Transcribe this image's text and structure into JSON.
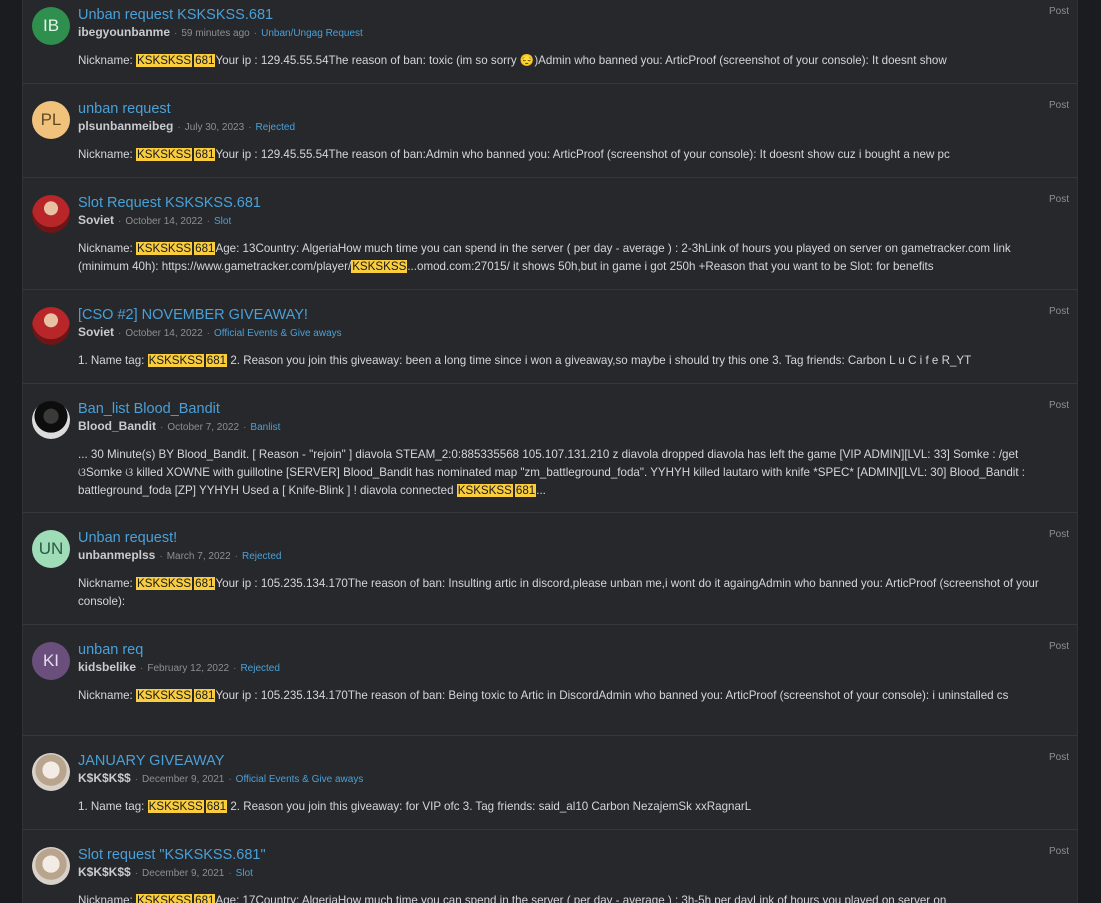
{
  "results": [
    {
      "title": "Unban request KSKSKSS.681",
      "avatar_initials": "IB",
      "avatar_color": "#2f8f4e",
      "author": "ibegyounbanme",
      "date": "59 minutes ago",
      "forum": "Unban/Ungag Request",
      "type": "Post",
      "snippet_pre": "Nickname: ",
      "hl1": "KSKSKSS",
      "hl2": "681",
      "snippet_post": "Your ip : 129.45.55.54The reason of ban: toxic (im so sorry 😔)Admin who banned you: ArticProof (screenshot of your console): It doesnt show"
    },
    {
      "title": "unban request",
      "avatar_initials": "PL",
      "avatar_color": "#f0c27b",
      "author": "plsunbanmeibeg",
      "date": "July 30, 2023",
      "forum": "Rejected",
      "type": "Post",
      "snippet_pre": "Nickname: ",
      "hl1": "KSKSKSS",
      "hl2": "681",
      "snippet_post": "Your ip : 129.45.55.54The reason of ban:Admin who banned you: ArticProof (screenshot of your console): It doesnt show cuz i bought a new pc"
    },
    {
      "title": "Slot Request KSKSKSS.681",
      "avatar_initials": "",
      "avatar_color": "#8b1a1a",
      "author": "Soviet",
      "date": "October 14, 2022",
      "forum": "Slot",
      "type": "Post",
      "snippet_pre": "Nickname: ",
      "hl1": "KSKSKSS",
      "hl2": "681",
      "snippet_mid": "Age: 13Country: AlgeriaHow much time you can spend in the server ( per day - average ) : 2-3hLink of hours you played on server on gametracker.com link (minimum 40h): https://www.gametracker.com/player/",
      "hl3": "KSKSKSS",
      "snippet_post": "...omod.com:27015/ it shows 50h,but in game i got 250h +Reason that you want to be Slot: for benefits"
    },
    {
      "title": "[CSO #2] NOVEMBER GIVEAWAY!",
      "avatar_initials": "",
      "avatar_color": "#8b1a1a",
      "author": "Soviet",
      "date": "October 14, 2022",
      "forum": "Official Events & Give aways",
      "type": "Post",
      "snippet_pre": "1. Name tag: ",
      "hl1": "KSKSKSS",
      "hl2": "681",
      "snippet_post": " 2. Reason you join this giveaway: been a long time since i won a giveaway,so maybe i should try this one 3. Tag friends: Carbon L u C i f e R_YT"
    },
    {
      "title": "Ban_list Blood_Bandit",
      "avatar_initials": "",
      "avatar_color": "#111111",
      "author": "Blood_Bandit",
      "date": "October 7, 2022",
      "forum": "Banlist",
      "type": "Post",
      "snippet_pre": "... 30 Minute(s) BY Blood_Bandit. [ Reason - \"rejoin\" ] diavola STEAM_2:0:885335568 105.107.131.210 z diavola dropped diavola has left the game [VIP ADMIN][LVL: 33] Somke : /get ଓSomke ଓ killed XOWNE with guillotine [SERVER] Blood_Bandit has nominated map \"zm_battleground_foda\". YYHYH killed lautaro with knife *SPEC* [ADMIN][LVL: 30] Blood_Bandit : battleground_foda [ZP] YYHYH Used a [ Knife-Blink ] ! diavola connected ",
      "hl1": "KSKSKSS",
      "hl2": "681",
      "snippet_post": "..."
    },
    {
      "title": "Unban request!",
      "avatar_initials": "UN",
      "avatar_color": "#9fdcb8",
      "author": "unbanmeplss",
      "date": "March 7, 2022",
      "forum": "Rejected",
      "type": "Post",
      "snippet_pre": "Nickname: ",
      "hl1": "KSKSKSS",
      "hl2": "681",
      "snippet_post": "Your ip : 105.235.134.170The reason of ban: Insulting artic in discord,please unban me,i wont do it againgAdmin who banned you: ArticProof (screenshot of your console):"
    },
    {
      "title": "unban req",
      "avatar_initials": "KI",
      "avatar_color": "#6a4f7d",
      "author": "kidsbelike",
      "date": "February 12, 2022",
      "forum": "Rejected",
      "type": "Post",
      "snippet_pre": "Nickname: ",
      "hl1": "KSKSKSS",
      "hl2": "681",
      "snippet_post": "Your ip : 105.235.134.170The reason of ban: Being toxic to Artic in DiscordAdmin who banned you: ArticProof (screenshot of your console): i uninstalled cs"
    },
    {
      "title": "JANUARY GIVEAWAY",
      "avatar_initials": "",
      "avatar_color": "#cfc6bc",
      "author": "K$K$K$$",
      "date": "December 9, 2021",
      "forum": "Official Events & Give aways",
      "type": "Post",
      "snippet_pre": "1. Name tag: ",
      "hl1": "KSKSKSS",
      "hl2": "681",
      "snippet_post": " 2. Reason you join this giveaway: for VIP ofc 3. Tag friends: said_al10 Carbon NezajemSk xxRagnarL"
    },
    {
      "title": "Slot request \"KSKSKSS.681\"",
      "avatar_initials": "",
      "avatar_color": "#cfc6bc",
      "author": "K$K$K$$",
      "date": "December 9, 2021",
      "forum": "Slot",
      "type": "Post",
      "snippet_pre": "Nickname: ",
      "hl1": "KSKSKSS",
      "hl2": "681",
      "snippet_post": "Age: 17Country: AlgeriaHow much time you can spend in the server ( per day - average ) : 3h-5h per dayLink of hours you played on server on"
    }
  ]
}
